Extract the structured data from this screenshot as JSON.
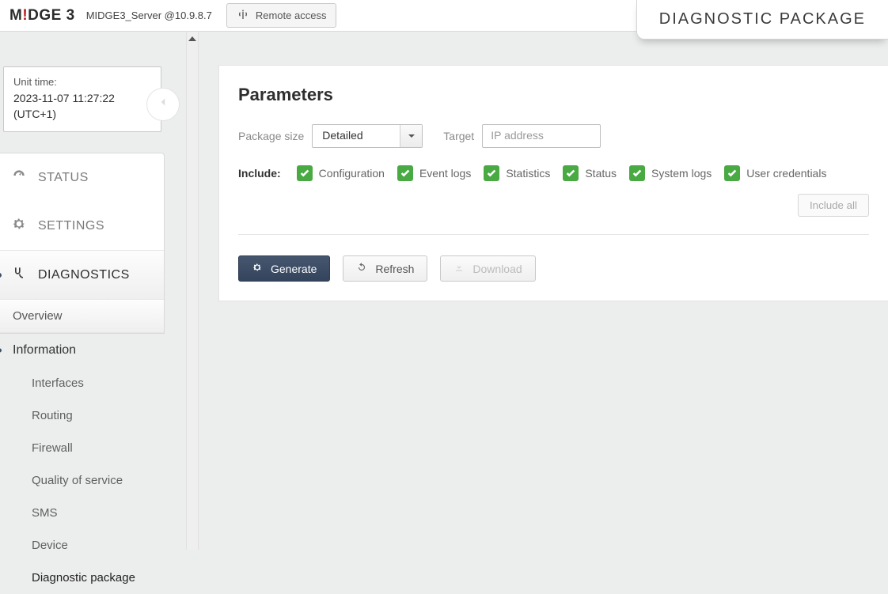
{
  "logo": {
    "m": "M",
    "bang": "!",
    "rest": "DGE",
    "three": "3"
  },
  "host": "MIDGE3_Server @10.9.8.7",
  "remote_access": "Remote access",
  "page_title": "DIAGNOSTIC PACKAGE",
  "time": {
    "label": "Unit time:",
    "value": "2023-11-07 11:27:22",
    "tz": "(UTC+1)"
  },
  "nav": {
    "status": "STATUS",
    "settings": "SETTINGS",
    "diagnostics": "DIAGNOSTICS",
    "overview": "Overview",
    "information": "Information",
    "children": [
      "Interfaces",
      "Routing",
      "Firewall",
      "Quality of service",
      "SMS",
      "Device",
      "Diagnostic package"
    ]
  },
  "panel": {
    "heading": "Parameters",
    "package_size_label": "Package size",
    "package_size_value": "Detailed",
    "target_label": "Target",
    "target_placeholder": "IP address",
    "include_label": "Include:",
    "options": [
      "Configuration",
      "Event logs",
      "Statistics",
      "Status",
      "System logs",
      "User credentials"
    ],
    "include_all": "Include all",
    "generate": "Generate",
    "refresh": "Refresh",
    "download": "Download"
  }
}
